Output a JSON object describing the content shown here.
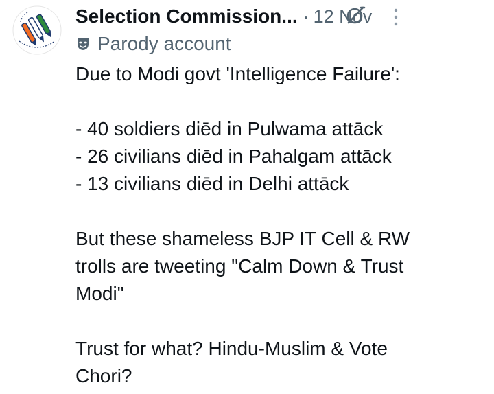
{
  "tweet": {
    "author": {
      "display_name": "Selection Commission...",
      "avatar_icon": "ballot-party-logo-icon"
    },
    "separator": "·",
    "date": "12 Nov",
    "account_label": "Parody account",
    "icons": {
      "grok": "grok-icon",
      "more": "more-vertical-icon",
      "label": "parody-mask-icon"
    },
    "text_lines": [
      "Due to Modi govt 'Intelligence Failure':",
      "",
      "- 40 soldiers diēd in Pulwama attāck",
      "- 26 civilians diēd in Pahalgam attāck",
      "- 13 civilians diēd in Delhi attāck",
      "",
      "But these shameless BJP IT Cell & RW",
      "trolls are tweeting \"Calm Down & Trust",
      "Modi\"",
      "",
      "Trust for what? Hindu-Muslim & Vote",
      "Chori?"
    ]
  },
  "colors": {
    "text_primary": "#0f1419",
    "text_secondary": "#536471",
    "saffron": "#f26b21",
    "green": "#2e8b3e",
    "navy": "#1f3a6e"
  }
}
